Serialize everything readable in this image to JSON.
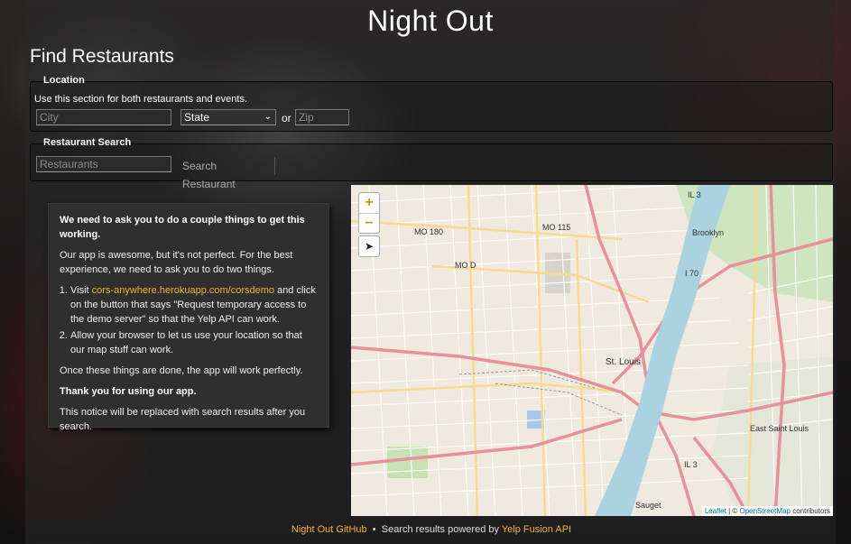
{
  "app": {
    "title": "Night Out",
    "section_title": "Find Restaurants"
  },
  "location": {
    "legend": "Location",
    "hint": "Use this section for both restaurants and events.",
    "city_placeholder": "City",
    "state_value": "State",
    "or_label": "or",
    "zip_placeholder": "Zip"
  },
  "restaurant_search": {
    "legend": "Restaurant Search",
    "input_placeholder": "Restaurants",
    "button_label": "Search Restaurant"
  },
  "notice": {
    "heading": "We need to ask you to do a couple things to get this working.",
    "intro": "Our app is awesome, but it's not perfect. For the best experience, we need to ask you to do two things.",
    "step1_prefix": "Visit ",
    "step1_link": "cors-anywhere.herokuapp.com/corsdemo",
    "step1_suffix": " and click on the button that says \"Request temporary access to the demo server\" so that the Yelp API can work.",
    "step2": "Allow your browser to let us use your location so that our map stuff can work.",
    "done": "Once these things are done, the app will work perfectly.",
    "thanks": "Thank you for using our app.",
    "replace_note": "This notice will be replaced with search results after you search."
  },
  "map": {
    "zoom_in": "+",
    "zoom_out": "−",
    "locate_glyph": "➤",
    "labels": {
      "mo180": "MO 180",
      "mo115": "MO 115",
      "mod": "MO D",
      "il3_top": "IL 3",
      "brooklyn": "Brooklyn",
      "i70": "I 70",
      "stlouis": "St. Louis",
      "east_st_louis": "East Saint Louis",
      "il3_bottom": "IL 3",
      "sauget": "Sauget"
    },
    "attribution_leaflet": "Leaflet",
    "attribution_sep": " | © ",
    "attribution_osm": "OpenStreetMap",
    "attribution_suffix": " contributors"
  },
  "footer": {
    "github_link": "Night Out GitHub",
    "separator": "•",
    "powered_prefix": "Search results powered by ",
    "yelp_link": "Yelp Fusion API"
  }
}
